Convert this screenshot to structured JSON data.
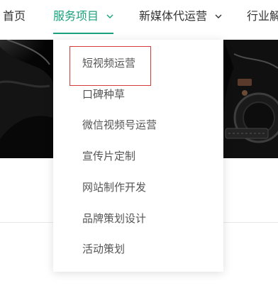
{
  "nav": {
    "items": [
      {
        "label": "首页"
      },
      {
        "label": "服务项目"
      },
      {
        "label": "新媒体代运营"
      },
      {
        "label": "行业解"
      }
    ],
    "active_color": "#1aa17d",
    "text_color": "#333333"
  },
  "dropdown": {
    "items": [
      {
        "label": "短视频运营"
      },
      {
        "label": "口碑种草"
      },
      {
        "label": "微信视频号运营"
      },
      {
        "label": "宣传片定制"
      },
      {
        "label": "网站制作开发"
      },
      {
        "label": "品牌策划设计"
      },
      {
        "label": "活动策划"
      }
    ],
    "highlight_color": "#d63b3b"
  },
  "icons": {
    "chevron": "chevron-down-icon"
  }
}
